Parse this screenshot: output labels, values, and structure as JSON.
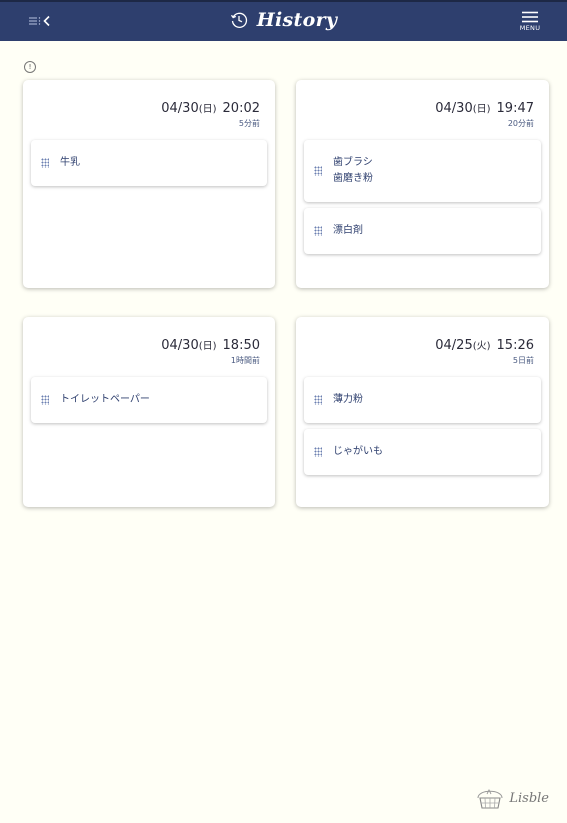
{
  "header": {
    "title": "History",
    "menu_label": "MENU"
  },
  "cards": [
    {
      "date": "04/30",
      "weekday": "(日)",
      "time": "20:02",
      "ago": "5分前",
      "items": [
        {
          "lines": [
            "牛乳"
          ]
        }
      ]
    },
    {
      "date": "04/30",
      "weekday": "(日)",
      "time": "19:47",
      "ago": "20分前",
      "items": [
        {
          "lines": [
            "歯ブラシ",
            "歯磨き粉"
          ]
        },
        {
          "lines": [
            "漂白剤"
          ]
        }
      ]
    },
    {
      "date": "04/30",
      "weekday": "(日)",
      "time": "18:50",
      "ago": "1時間前",
      "items": [
        {
          "lines": [
            "トイレットペーパー"
          ]
        }
      ]
    },
    {
      "date": "04/25",
      "weekday": "(火)",
      "time": "15:26",
      "ago": "5日前",
      "items": [
        {
          "lines": [
            "薄力粉"
          ]
        },
        {
          "lines": [
            "じゃがいも"
          ]
        }
      ]
    }
  ],
  "logo": {
    "text": "Lisble"
  },
  "colors": {
    "header_bg": "#2e3f6e",
    "page_bg": "#fffff6",
    "item_text": "#2e3f6e"
  }
}
